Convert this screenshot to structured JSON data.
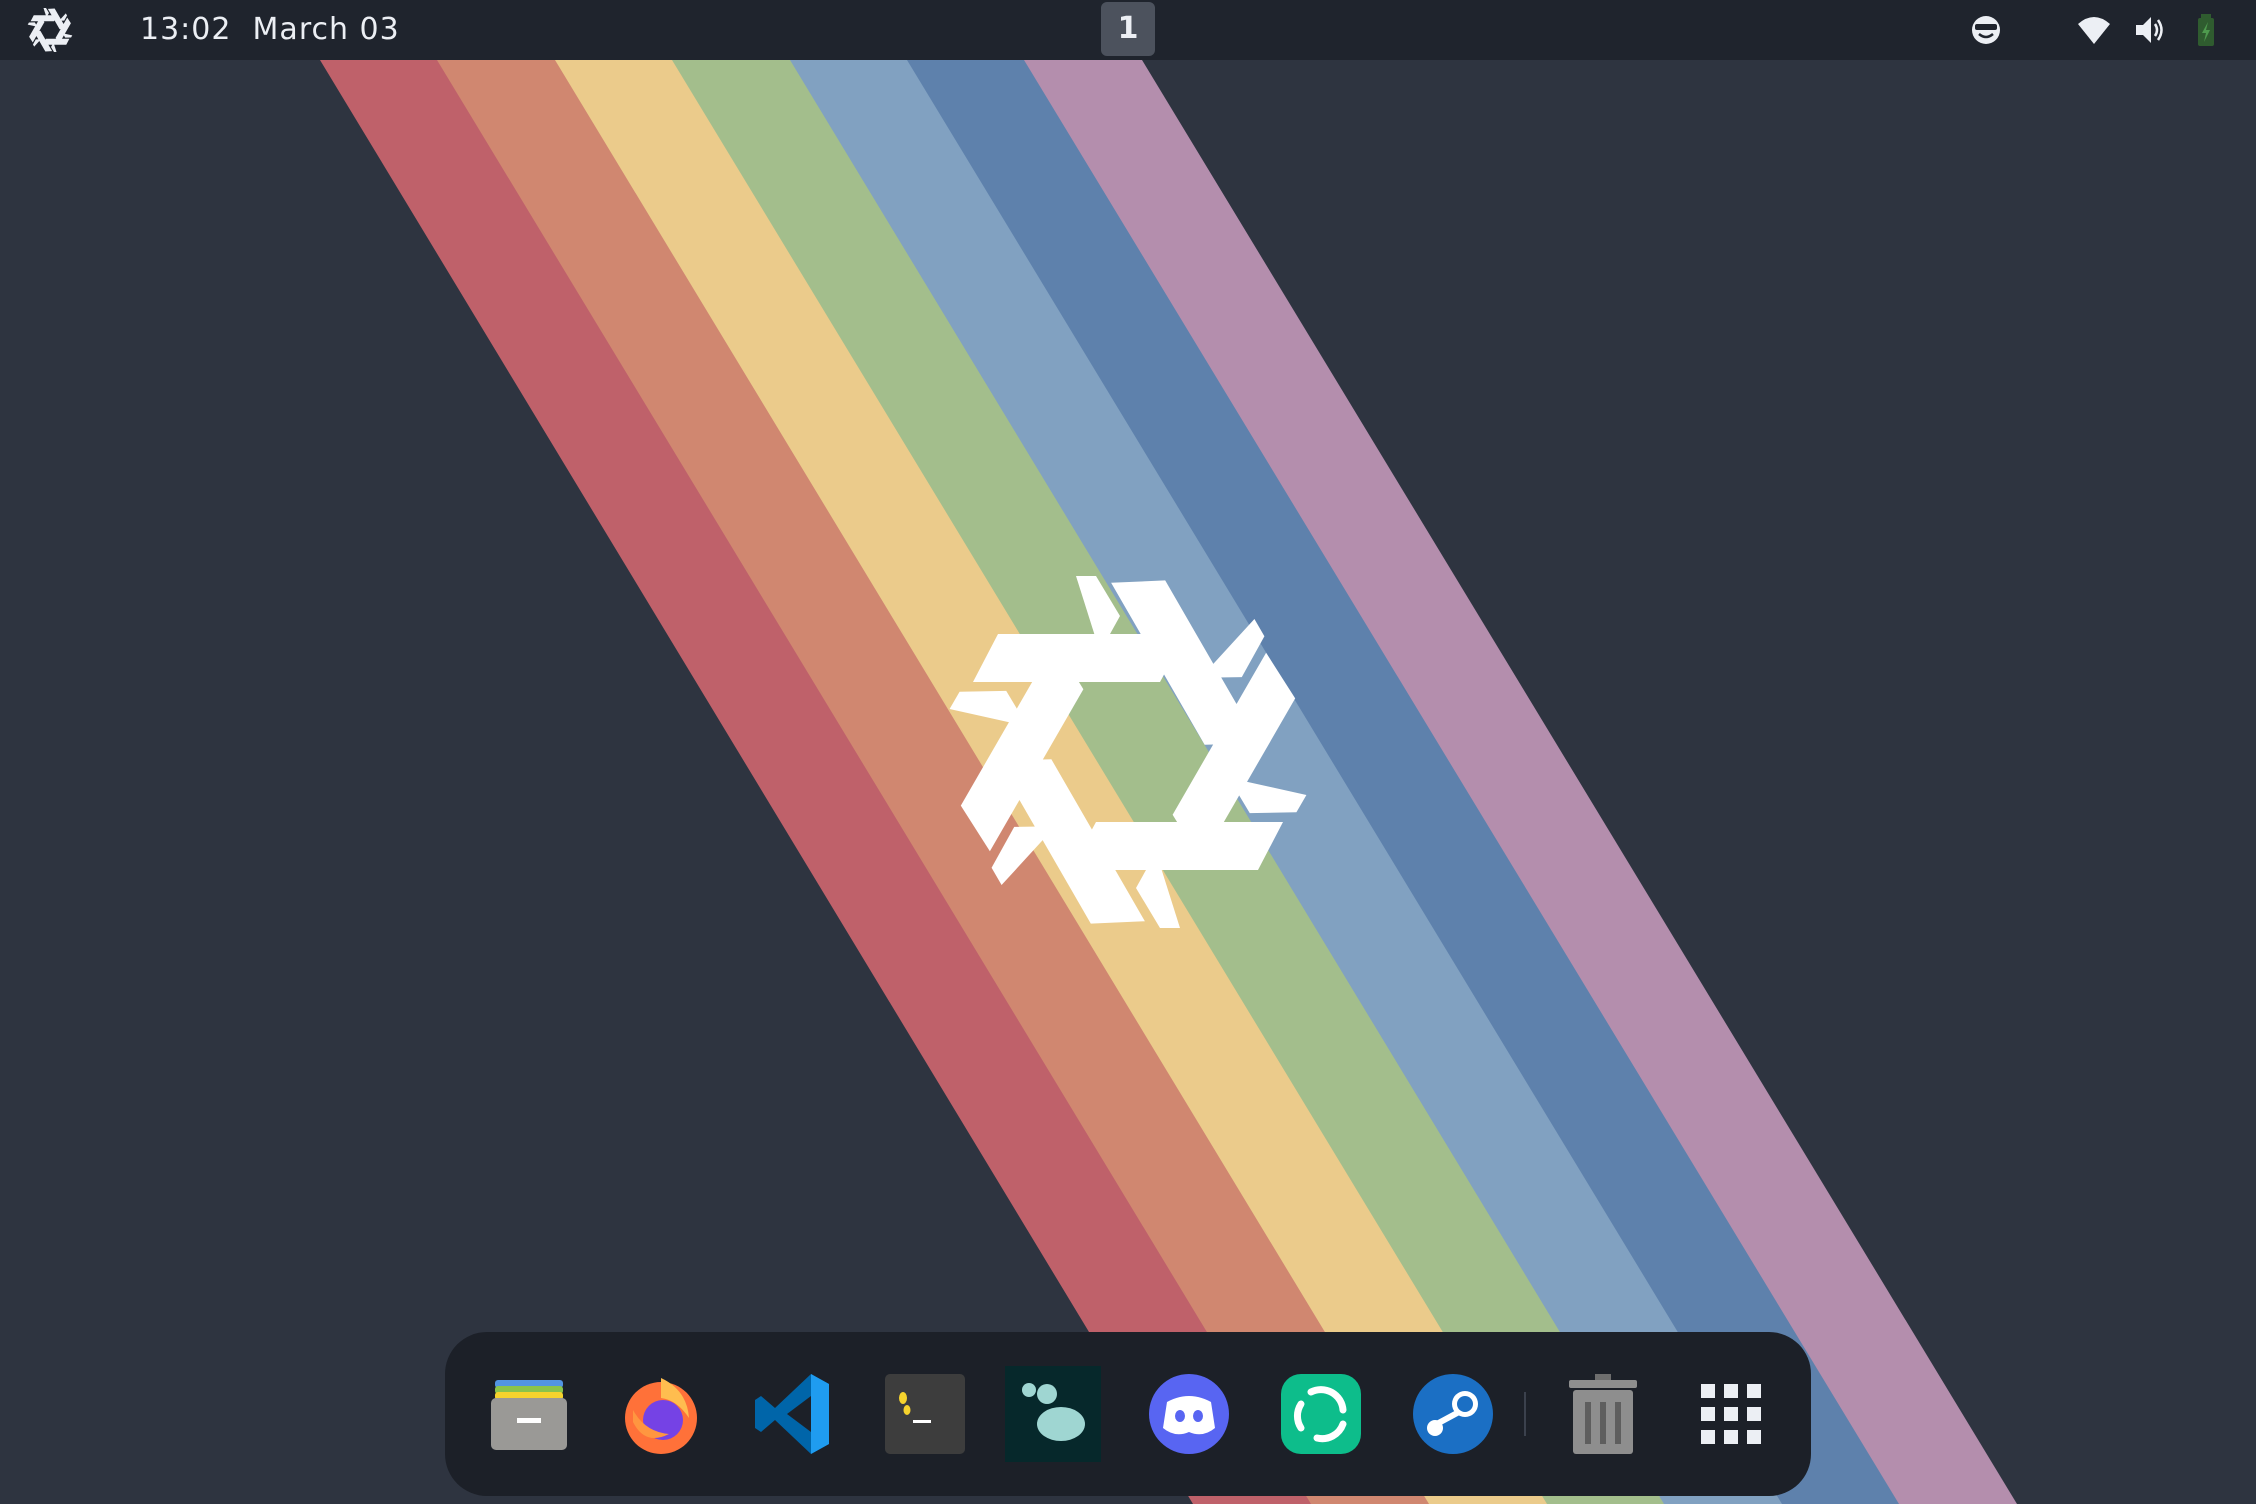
{
  "topbar": {
    "logo_icon": "nixos-snowflake-icon",
    "time": "13:02",
    "date": "March 03",
    "workspace": "1",
    "tray": [
      "sunglasses-face-icon",
      "wifi-icon",
      "volume-icon",
      "battery-icon"
    ]
  },
  "wallpaper": {
    "background": "#2e3440",
    "stripes": [
      "#bf616a",
      "#d08770",
      "#ebcb8b",
      "#a3be8c",
      "#81a1c1",
      "#5e81ac",
      "#b48ead"
    ],
    "logo_icon": "nixos-snowflake-icon"
  },
  "dock": {
    "items": [
      {
        "name": "files-app",
        "icon": "file-cabinet-icon"
      },
      {
        "name": "firefox",
        "icon": "firefox-icon"
      },
      {
        "name": "vscode",
        "icon": "vscode-icon"
      },
      {
        "name": "terminal",
        "icon": "terminal-icon"
      },
      {
        "name": "blob-app",
        "icon": "blob-icon"
      },
      {
        "name": "discord",
        "icon": "discord-icon"
      },
      {
        "name": "element",
        "icon": "element-icon"
      },
      {
        "name": "steam",
        "icon": "steam-icon"
      },
      {
        "name": "trash",
        "icon": "trash-icon"
      },
      {
        "name": "show-apps",
        "icon": "app-grid-icon"
      }
    ]
  }
}
